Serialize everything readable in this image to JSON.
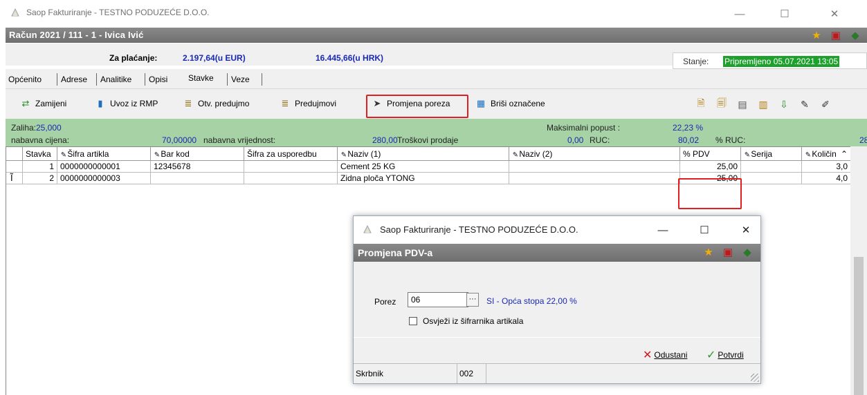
{
  "window": {
    "title": "Saop Fakturiranje - TESTNO PODUZEĆE D.O.O.",
    "minimize": "—",
    "maximize": "☐",
    "close": "✕"
  },
  "document": {
    "title": "Račun  2021 / 111 - 1 - Ivica Ivić",
    "pay_label": "Za plaćanje:",
    "pay_eur": "2.197,64(u EUR)",
    "pay_hrk": "16.445,66(u HRK)",
    "stanje_label": "Stanje:",
    "stanje_value": "Pripremljeno 05.07.2021 13:05"
  },
  "tabs": [
    "Općenito",
    "Adrese",
    "Analitike",
    "Opisi",
    "Stavke",
    "Veze"
  ],
  "toolbar": {
    "zamijeni": "Zamijeni",
    "uvoz": "Uvoz iz RMP",
    "otv_predujmo": "Otv. predujmo",
    "predujmovi": "Predujmovi",
    "promjena_poreza": "Promjena poreza",
    "brisi": "Briši označene"
  },
  "info": {
    "zaliha_label": "Zaliha:",
    "zaliha_value": "25,000",
    "max_popust_label": "Maksimalni popust :",
    "max_popust_value": "22,23 %",
    "nab_cijena_label": "nabavna cijena:",
    "nab_cijena_value": "70,00000",
    "nab_vrijednost_label": "nabavna vrijednost:",
    "nab_vrijednost_value": "280,00",
    "troskovi_label": "Troškovi prodaje",
    "troskovi_value": "0,00",
    "ruc_label": "RUC:",
    "ruc_value": "80,02",
    "pruc_label": "% RUC:",
    "pruc_value": "28"
  },
  "grid": {
    "headers": [
      "Stavka",
      "Šifra artikla",
      "Bar kod",
      "Šifra za usporedbu",
      "Naziv (1)",
      "Naziv (2)",
      "% PDV",
      "Serija",
      "Količin"
    ],
    "rows": [
      {
        "stavka": "1",
        "sifra": "0000000000001",
        "barkod": "12345678",
        "usporedba": "",
        "naziv1": "Cement 25 KG",
        "naziv2": "",
        "pdv": "25,00",
        "serija": "",
        "kolicina": "3,0"
      },
      {
        "stavka": "2",
        "sifra": "0000000000003",
        "barkod": "",
        "usporedba": "",
        "naziv1": "Zidna ploča YTONG",
        "naziv2": "",
        "pdv": "25,00",
        "serija": "",
        "kolicina": "4,0"
      }
    ]
  },
  "dialog": {
    "title": "Saop Fakturiranje - TESTNO PODUZEĆE D.O.O.",
    "header": "Promjena PDV-a",
    "porez_label": "Porez",
    "porez_value": "06",
    "porez_desc": "SI - Opća stopa 22,00 %",
    "checkbox_label": "Osvježi iz šifrarnika artikala",
    "cancel": "Odustani",
    "confirm": "Potvrdi",
    "status_user": "Skrbnik",
    "status_code": "002"
  },
  "colors": {
    "accent_blue": "#1a29b3",
    "info_green": "#a6d2a6",
    "status_green": "#1ea02c",
    "highlight_red": "#e02020"
  }
}
